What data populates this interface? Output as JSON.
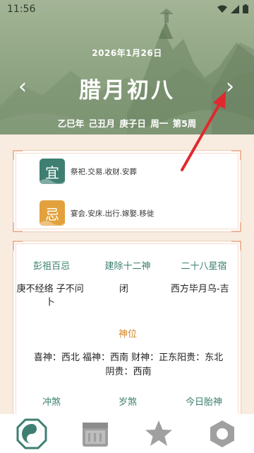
{
  "status_bar": {
    "time": "11:56"
  },
  "header": {
    "solar_date": "2026年1月26日",
    "lunar_date": "腊月初八",
    "ganzhi": "乙巳年 己丑月 庚子日 周一 第5周",
    "prev_arrow": "‹",
    "next_arrow": "›"
  },
  "yiji": {
    "yi_label": "宜",
    "yi_text": "祭祀.交易.收财.安葬",
    "ji_label": "忌",
    "ji_text": "宴会.安床.出行.嫁娶.移徙"
  },
  "details": {
    "headers": [
      "彭祖百忌",
      "建除十二神",
      "二十八星宿"
    ],
    "values": [
      "庚不经络 子不问卜",
      "闭",
      "西方毕月乌-吉"
    ],
    "shenwei_title": "神位",
    "shenwei_text": "喜神：西北 福神：西南 财神：正东阳贵：东北 阴贵：西南",
    "headers2": [
      "冲煞",
      "岁煞",
      "今日胎神"
    ]
  },
  "tabs": [
    "yin-yang-icon",
    "calendar-icon",
    "star-icon",
    "hexagon-icon"
  ],
  "colors": {
    "header_green": "#8ea482",
    "accent_green": "#3c8070",
    "accent_orange": "#d48526",
    "yi_badge": "#3e7f72",
    "ji_badge": "#e2a13c",
    "annotation_red": "#e0292e"
  }
}
